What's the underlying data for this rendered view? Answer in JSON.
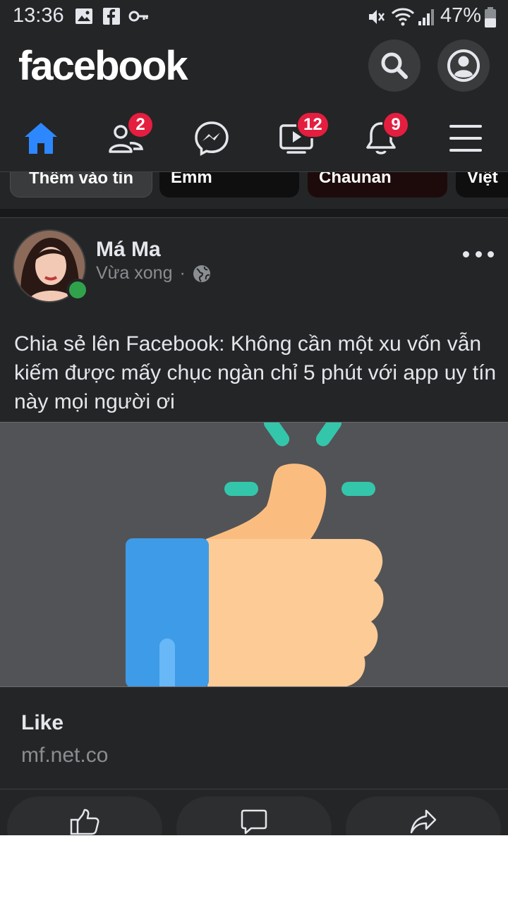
{
  "status_bar": {
    "time": "13:36",
    "left_icons": [
      "image-icon",
      "facebook-icon",
      "key-icon"
    ],
    "right_icons": [
      "mute-icon",
      "wifi-icon",
      "signal-icon",
      "battery-icon"
    ],
    "battery": "47%"
  },
  "app_bar": {
    "logo": "facebook",
    "search_icon": "search-icon",
    "profile_icon": "profile-icon"
  },
  "tabs": [
    {
      "id": "home",
      "icon": "home-icon",
      "active": true,
      "badge": ""
    },
    {
      "id": "friends",
      "icon": "friends-icon",
      "active": false,
      "badge": "2"
    },
    {
      "id": "messenger",
      "icon": "messenger-icon",
      "active": false,
      "badge": ""
    },
    {
      "id": "watch",
      "icon": "video-icon",
      "active": false,
      "badge": "12"
    },
    {
      "id": "notifications",
      "icon": "bell-icon",
      "active": false,
      "badge": "9"
    },
    {
      "id": "menu",
      "icon": "menu-icon",
      "active": false,
      "badge": ""
    }
  ],
  "stories": [
    "Thêm vào tin",
    "Emm",
    "Chaunan",
    "Việt"
  ],
  "post": {
    "author": "Má Ma",
    "time": "Vừa xong",
    "separator": "·",
    "privacy_icon": "globe-icon",
    "text": "Chia sẻ lên Facebook: Không cần một xu vốn vẫn kiếm được mấy chục ngàn chỉ 5 phút với app uy tín này mọi người ơi",
    "link": {
      "title": "Like",
      "domain": "mf.net.co"
    },
    "actions": [
      {
        "id": "like",
        "icon": "like-icon"
      },
      {
        "id": "comment",
        "icon": "comment-icon"
      },
      {
        "id": "share",
        "icon": "share-icon"
      }
    ]
  },
  "colors": {
    "accent": "#1877f2",
    "badge": "#e41e3f",
    "online": "#31a24c",
    "surface": "#242526"
  }
}
